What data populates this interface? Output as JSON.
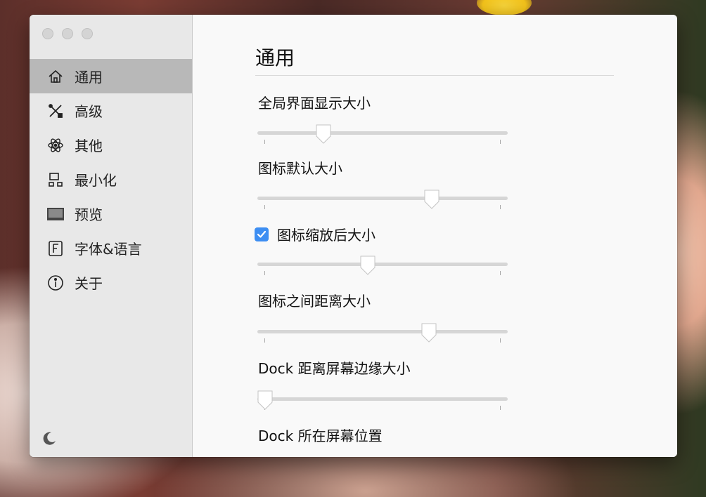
{
  "window": {
    "controls": [
      "close",
      "minimize",
      "zoom"
    ]
  },
  "sidebar": {
    "items": [
      {
        "label": "通用",
        "icon": "home-icon",
        "active": true
      },
      {
        "label": "高级",
        "icon": "tools-icon",
        "active": false
      },
      {
        "label": "其他",
        "icon": "atom-icon",
        "active": false
      },
      {
        "label": "最小化",
        "icon": "minimize-icon",
        "active": false
      },
      {
        "label": "预览",
        "icon": "preview-icon",
        "active": false
      },
      {
        "label": "字体&语言",
        "icon": "font-icon",
        "active": false
      },
      {
        "label": "关于",
        "icon": "info-icon",
        "active": false
      }
    ],
    "footer_icon": "moon-icon"
  },
  "main": {
    "title": "通用",
    "settings": [
      {
        "label": "全局界面显示大小",
        "slider_value": 0.265
      },
      {
        "label": "图标默认大小",
        "slider_value": 0.697
      },
      {
        "label": "图标缩放后大小",
        "checkbox": true,
        "checked": true,
        "slider_value": 0.44
      },
      {
        "label": "图标之间距离大小",
        "slider_value": 0.685
      },
      {
        "label": "Dock 距离屏幕边缘大小",
        "slider_value": 0.03
      },
      {
        "label": "Dock 所在屏幕位置"
      }
    ]
  },
  "colors": {
    "accent": "#3d8ef2",
    "sidebar_bg": "#e8e8e8",
    "sidebar_active": "#b8b8b8",
    "content_bg": "#f9f9f9"
  }
}
